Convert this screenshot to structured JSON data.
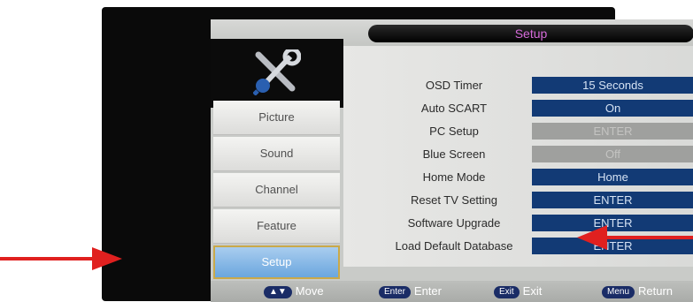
{
  "menu": {
    "title": "Setup",
    "sidebar": [
      {
        "label": "Picture"
      },
      {
        "label": "Sound"
      },
      {
        "label": "Channel"
      },
      {
        "label": "Feature"
      },
      {
        "label": "Setup",
        "active": true
      }
    ],
    "rows": [
      {
        "label": "OSD Timer",
        "value": "15 Seconds",
        "enabled": true,
        "has_arrow": true
      },
      {
        "label": "Auto SCART",
        "value": "On",
        "enabled": true,
        "has_arrow": true
      },
      {
        "label": "PC Setup",
        "value": "ENTER",
        "enabled": false,
        "has_arrow": false
      },
      {
        "label": "Blue Screen",
        "value": "Off",
        "enabled": false,
        "has_arrow": false
      },
      {
        "label": "Home Mode",
        "value": "Home",
        "enabled": true,
        "has_arrow": true
      },
      {
        "label": "Reset TV Setting",
        "value": "ENTER",
        "enabled": true,
        "has_arrow": true
      },
      {
        "label": "Software Upgrade",
        "value": "ENTER",
        "enabled": true,
        "has_arrow": true
      },
      {
        "label": "Load Default Database",
        "value": "ENTER",
        "enabled": true,
        "has_arrow": false
      }
    ],
    "footer": {
      "move_key": "▲▼",
      "move_label": "Move",
      "enter_key": "Enter",
      "enter_label": "Enter",
      "exit_key": "Exit",
      "exit_label": "Exit",
      "menu_key": "Menu",
      "menu_label": "Return"
    }
  },
  "colors": {
    "value_bg": "#123a75",
    "active_sidebar": "#6aa6de",
    "title_text": "#d56ad9",
    "annotation_arrow": "#e0201f"
  }
}
